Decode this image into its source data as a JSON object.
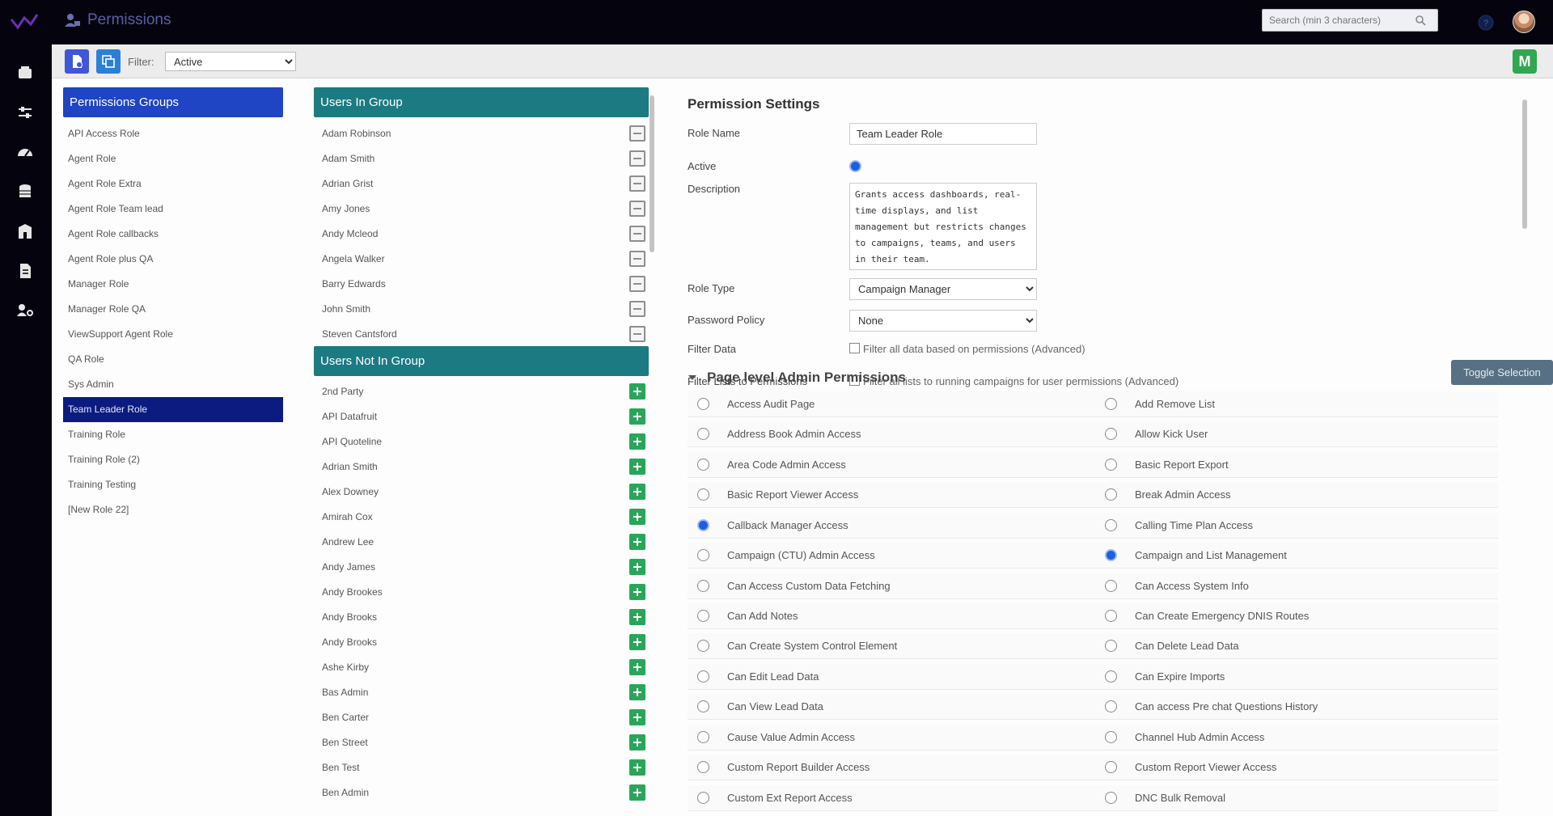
{
  "topbar": {
    "title": "Permissions",
    "search_placeholder": "Search (min 3 characters)"
  },
  "toolbar": {
    "filter_label": "Filter:",
    "filter_value": "Active",
    "badge": "M"
  },
  "groups": {
    "header": "Permissions Groups",
    "items": [
      "API Access Role",
      "Agent Role",
      "Agent Role Extra",
      "Agent Role Team lead",
      "Agent Role callbacks",
      "Agent Role plus QA",
      "Manager Role",
      "Manager Role QA",
      "ViewSupport Agent Role",
      "QA Role",
      "Sys Admin",
      "Team Leader Role",
      "Training Role",
      "Training Role (2)",
      "Training Testing",
      "[New Role 22]"
    ],
    "selected": "Team Leader Role"
  },
  "users_in": {
    "header": "Users In Group",
    "items": [
      "Adam Robinson",
      "Adam Smith",
      "Adrian Grist",
      "Amy Jones",
      "Andy Mcleod",
      "Angela Walker",
      "Barry Edwards",
      "John Smith",
      "Steven Cantsford"
    ]
  },
  "users_out": {
    "header": "Users Not In Group",
    "items": [
      "2nd Party",
      "API Datafruit",
      "API Quoteline",
      "Adrian Smith",
      "Alex Downey",
      "Amirah Cox",
      "Andrew Lee",
      "Andy James",
      "Andy Brookes",
      "Andy Brooks",
      "Andy Brooks",
      "Ashe Kirby",
      "Bas Admin",
      "Ben Carter",
      "Ben Street",
      "Ben Test",
      "Ben Admin"
    ]
  },
  "settings": {
    "title": "Permission Settings",
    "role_name_label": "Role Name",
    "role_name_value": "Team Leader Role",
    "active_label": "Active",
    "description_label": "Description",
    "description_value": "Grants access dashboards, real-time displays, and list management but restricts changes to campaigns, teams, and users in their team.",
    "role_type_label": "Role Type",
    "role_type_value": "Campaign Manager",
    "password_policy_label": "Password Policy",
    "password_policy_value": "None",
    "filter_data_label": "Filter Data",
    "filter_data_text": "Filter all data based on permissions (Advanced)",
    "filter_lists_label": "Filter Lists to Permissions",
    "filter_lists_text": "Filter all lists to running campaigns for user permissions (Advanced)",
    "section_title": "Page level Admin Permissions",
    "toggle_label": "Toggle Selection"
  },
  "permissions": [
    {
      "label": "Access Audit Page",
      "checked": false
    },
    {
      "label": "Add Remove List",
      "checked": false
    },
    {
      "label": "Address Book Admin Access",
      "checked": false
    },
    {
      "label": "Allow Kick User",
      "checked": false
    },
    {
      "label": "Area Code Admin Access",
      "checked": false
    },
    {
      "label": "Basic Report Export",
      "checked": false
    },
    {
      "label": "Basic Report Viewer Access",
      "checked": false
    },
    {
      "label": "Break Admin Access",
      "checked": false
    },
    {
      "label": "Callback Manager Access",
      "checked": true
    },
    {
      "label": "Calling Time Plan Access",
      "checked": false
    },
    {
      "label": "Campaign (CTU) Admin Access",
      "checked": false
    },
    {
      "label": "Campaign and List Management",
      "checked": true
    },
    {
      "label": "Can Access Custom Data Fetching",
      "checked": false
    },
    {
      "label": "Can Access System Info",
      "checked": false
    },
    {
      "label": "Can Add Notes",
      "checked": false
    },
    {
      "label": "Can Create Emergency DNIS Routes",
      "checked": false
    },
    {
      "label": "Can Create System Control Element",
      "checked": false
    },
    {
      "label": "Can Delete Lead Data",
      "checked": false
    },
    {
      "label": "Can Edit Lead Data",
      "checked": false
    },
    {
      "label": "Can Expire Imports",
      "checked": false
    },
    {
      "label": "Can View Lead Data",
      "checked": false
    },
    {
      "label": "Can access Pre chat Questions History",
      "checked": false
    },
    {
      "label": "Cause Value Admin Access",
      "checked": false
    },
    {
      "label": "Channel Hub Admin Access",
      "checked": false
    },
    {
      "label": "Custom Report Builder Access",
      "checked": false
    },
    {
      "label": "Custom Report Viewer Access",
      "checked": false
    },
    {
      "label": "Custom Ext Report Access",
      "checked": false
    },
    {
      "label": "DNC Bulk Removal",
      "checked": false
    }
  ]
}
